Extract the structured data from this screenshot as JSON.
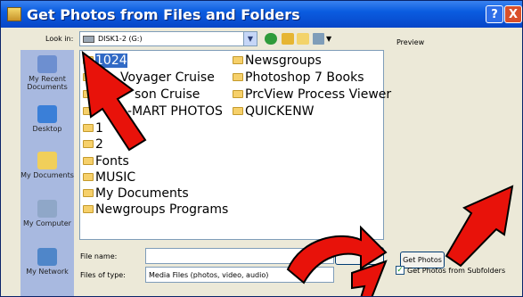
{
  "window": {
    "title": "Get Photos from Files and Folders",
    "help_label": "?",
    "close_label": "X"
  },
  "toolbar": {
    "look_in_label": "Look in:",
    "look_in_value": "DISK1-2 (G:)",
    "icons": [
      "back-icon",
      "up-folder-icon",
      "new-folder-icon",
      "views-icon"
    ]
  },
  "preview": {
    "label": "Preview"
  },
  "places": [
    {
      "label": "My Recent Documents",
      "icon": "recent-documents-icon"
    },
    {
      "label": "Desktop",
      "icon": "desktop-icon"
    },
    {
      "label": "My Documents",
      "icon": "my-documents-icon"
    },
    {
      "label": "My Computer",
      "icon": "my-computer-icon"
    },
    {
      "label": "My Network",
      "icon": "my-network-icon"
    }
  ],
  "files": {
    "column1": [
      "1024",
      "Voyager Cruise",
      "son Cruise",
      "-MART PHOTOS",
      "1",
      "2",
      "Fonts",
      "MUSIC",
      "My Documents",
      "Newgroups Programs"
    ],
    "column2": [
      "Newsgroups",
      "Photoshop 7 Books",
      "PrcView Process Viewer",
      "QUICKENW"
    ],
    "selected": "1024"
  },
  "form": {
    "filename_label": "File name:",
    "filename_value": "",
    "filetype_label": "Files of type:",
    "filetype_value": "Media Files (photos, video, audio)"
  },
  "buttons": {
    "get_photos": "Get Photos"
  },
  "options": {
    "subfolders_label": "Get Photos from Subfolders",
    "subfolders_checked": true
  },
  "colors": {
    "title_bar": "#0a5ce0",
    "selection": "#316ac5",
    "arrow": "#e8120a"
  }
}
